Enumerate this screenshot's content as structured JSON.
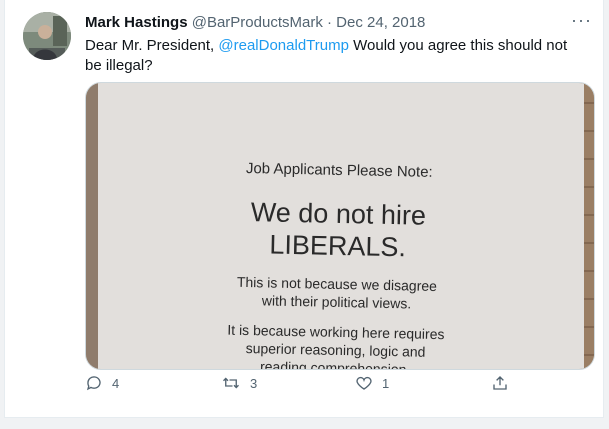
{
  "tweet": {
    "author_name": "Mark Hastings",
    "handle": "@BarProductsMark",
    "separator": "·",
    "date": "Dec 24, 2018",
    "more_label": "···",
    "text_before": "Dear Mr. President, ",
    "mention": "@realDonaldTrump",
    "text_after": " Would you agree this should not be illegal?"
  },
  "media": {
    "line1": "Job Applicants Please Note:",
    "line2": "We do not hire",
    "line3": "LIBERALS.",
    "line4": "This is not because we disagree",
    "line5": "with their political views.",
    "line6": "It is because working here requires",
    "line7": "superior reasoning, logic and",
    "line8": "reading comprehension."
  },
  "actions": {
    "reply_count": "4",
    "retweet_count": "3",
    "like_count": "1"
  },
  "colors": {
    "accent": "#1d9bf0",
    "muted": "#536471",
    "text": "#0f1419"
  }
}
